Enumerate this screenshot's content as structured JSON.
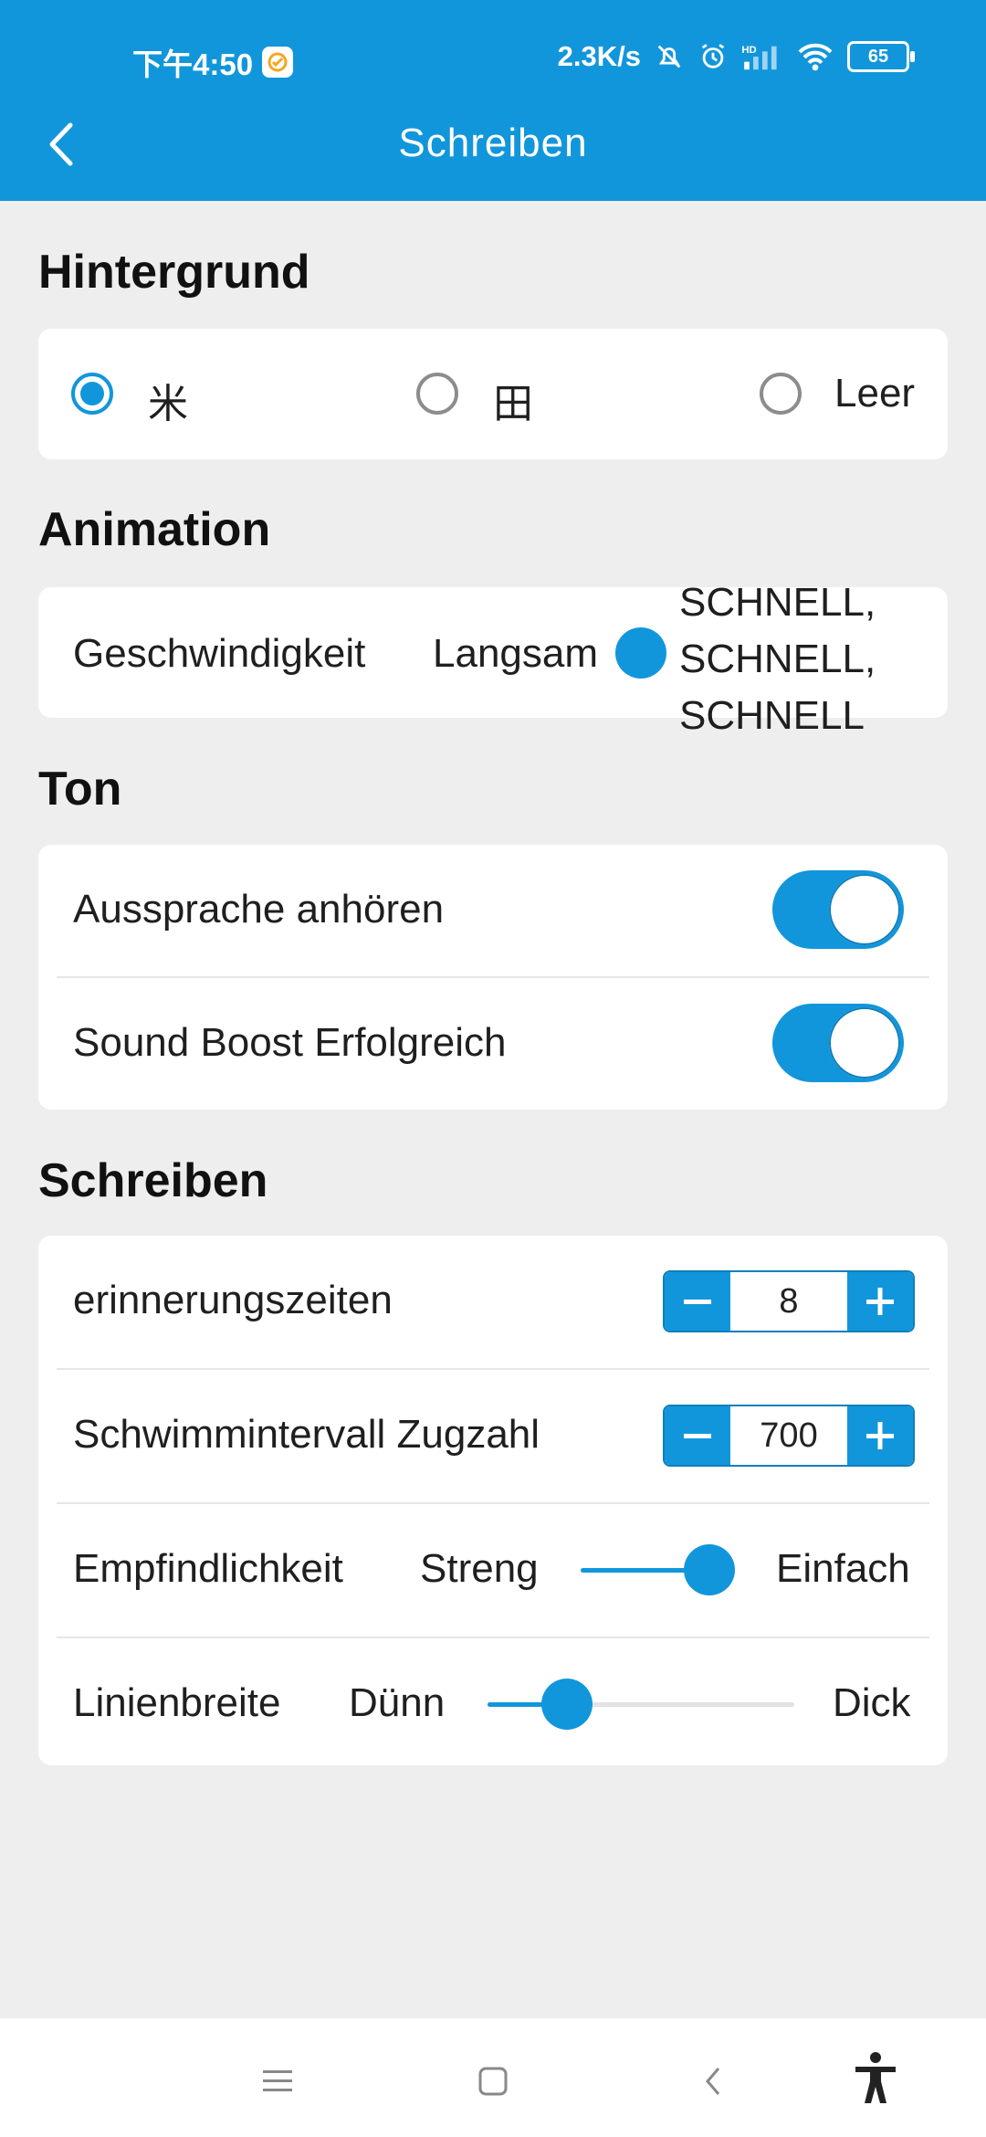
{
  "status_bar": {
    "time": "下午4:50",
    "network_speed": "2.3K/s",
    "battery": "65",
    "icons": [
      "app-badge-icon",
      "mute-bell-icon",
      "alarm-icon",
      "hd-signal-icon",
      "wifi-icon",
      "battery-icon"
    ]
  },
  "header": {
    "title": "Schreiben",
    "back_icon": "chevron-left-icon"
  },
  "sections": {
    "background": {
      "title": "Hintergrund",
      "options": [
        {
          "label": "米",
          "checked": true
        },
        {
          "label": "田",
          "checked": false
        },
        {
          "label": "Leer",
          "checked": false
        }
      ]
    },
    "animation": {
      "title": "Animation",
      "speed_label": "Geschwindigkeit",
      "slow_label": "Langsam",
      "fast_label": "SCHNELL, SCHNELL, SCHNELL"
    },
    "sound": {
      "title": "Ton",
      "items": [
        {
          "label": "Aussprache anhören",
          "on": true
        },
        {
          "label": "Sound Boost Erfolgreich",
          "on": true
        }
      ]
    },
    "writing": {
      "title": "Schreiben",
      "reminders": {
        "label": "erinnerungszeiten",
        "value": "8"
      },
      "swim_interval": {
        "label": "Schwimmintervall Zugzahl",
        "value": "700"
      },
      "sensitivity": {
        "label": "Empfindlichkeit",
        "min": "Streng",
        "max": "Einfach",
        "level": 0.85
      },
      "line_width": {
        "label": "Linienbreite",
        "min": "Dünn",
        "max": "Dick",
        "level": 0.26
      }
    }
  },
  "nav": {
    "icons": [
      "menu-icon",
      "home-icon",
      "back-icon",
      "accessibility-icon"
    ]
  },
  "colors": {
    "accent": "#1296DB",
    "background": "#EEEEEE",
    "card": "#FFFFFF"
  }
}
